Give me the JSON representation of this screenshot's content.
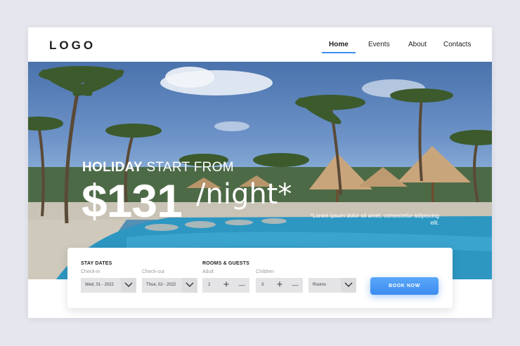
{
  "header": {
    "logo": "LOGO",
    "nav": [
      "Home",
      "Events",
      "About",
      "Contacts"
    ],
    "active": "Home",
    "accent_color": "#3d8ef0"
  },
  "hero": {
    "headline_bold": "HOLIDAY",
    "headline_rest": " START FROM",
    "price": "$131",
    "per": "/night*",
    "fine_print": "*Lorem ipsum dolor sit amet, consectetur adipiscing elit."
  },
  "booking": {
    "stay_title": "STAY DATES",
    "checkin_label": "Check-in",
    "checkin_value": "Wed, 01 - 2022",
    "checkout_label": "Check-out",
    "checkout_value": "Thue, 02 - 2022",
    "rooms_title": "ROOMS & GUESTS",
    "adult_label": "Adult",
    "adult_value": "2",
    "children_label": "Children",
    "children_value": "3",
    "rooms_value": "Rooms",
    "plus": "+",
    "minus": "—",
    "button": "BOOK NOW",
    "button_color": "#3b8cf0"
  }
}
